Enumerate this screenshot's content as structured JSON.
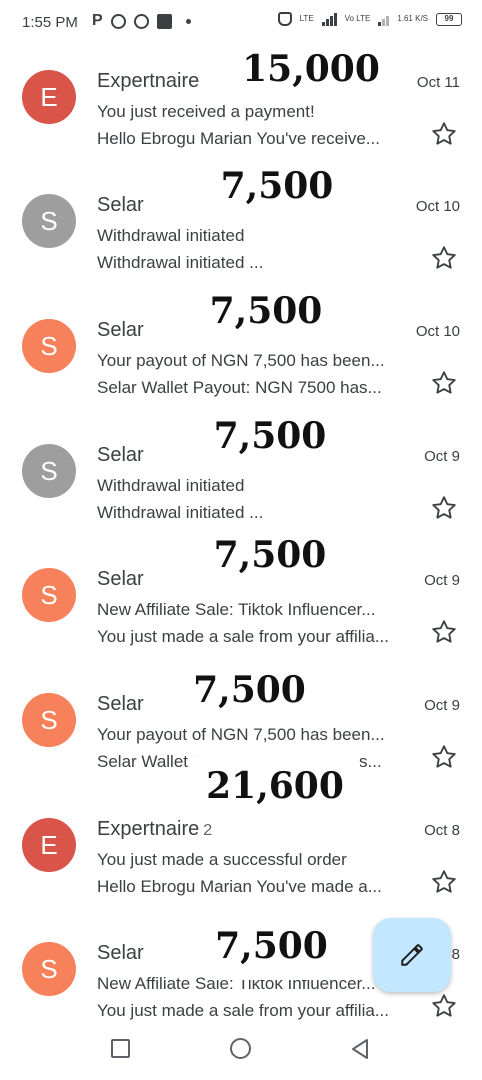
{
  "status_bar": {
    "time": "1:55 PM",
    "left_icons": [
      "p-icon",
      "whatsapp-icon",
      "facebook-icon",
      "photo-icon",
      "notification-dot"
    ],
    "lte1": "LTE",
    "lte2": "Vo LTE",
    "speed": "1.61 K/S",
    "battery": "99"
  },
  "emails": [
    {
      "initial": "E",
      "avatar_color": "#d9554a",
      "sender": "Expertnaire",
      "count": "",
      "date": "Oct 11",
      "subject": "You just received a payment!",
      "preview": "Hello Ebrogu Marian You've receive...",
      "overlay": "15,000"
    },
    {
      "initial": "S",
      "avatar_color": "#9e9e9e",
      "sender": "Selar",
      "count": "",
      "date": "Oct 10",
      "subject": "Withdrawal initiated",
      "preview": "Withdrawal initiated ...",
      "overlay": "7,500"
    },
    {
      "initial": "S",
      "avatar_color": "#f7815b",
      "sender": "Selar",
      "count": "",
      "date": "Oct 10",
      "subject": "Your payout of NGN 7,500 has been...",
      "preview": "Selar Wallet Payout: NGN 7500 has...",
      "overlay": "7,500"
    },
    {
      "initial": "S",
      "avatar_color": "#9e9e9e",
      "sender": "Selar",
      "count": "",
      "date": "Oct 9",
      "subject": "Withdrawal initiated",
      "preview": "Withdrawal initiated ...",
      "overlay": "7,500"
    },
    {
      "initial": "S",
      "avatar_color": "#f7815b",
      "sender": "Selar",
      "count": "",
      "date": "Oct 9",
      "subject": "New Affiliate Sale: Tiktok Influencer...",
      "preview": "You just made a sale from your affilia...",
      "overlay": "7,500"
    },
    {
      "initial": "S",
      "avatar_color": "#f7815b",
      "sender": "Selar",
      "count": "",
      "date": "Oct 9",
      "subject": "Your payout of NGN 7,500 has been...",
      "preview": "Selar Wallet Payout: NGN 7500 has...",
      "overlay": "7,500"
    },
    {
      "initial": "E",
      "avatar_color": "#d9554a",
      "sender": "Expertnaire",
      "count": "2",
      "date": "Oct 8",
      "subject": "You just made a successful order",
      "preview": "Hello Ebrogu Marian You've made a...",
      "overlay": "21,600"
    },
    {
      "initial": "S",
      "avatar_color": "#f7815b",
      "sender": "Selar",
      "count": "",
      "date": "Oct 8",
      "subject": "New Affiliate Sale: Tiktok Influencer...",
      "preview": "You just made a sale from your affilia...",
      "overlay": "7,500"
    }
  ],
  "fab": {
    "icon": "pencil-icon",
    "color": "#c2e7ff"
  },
  "nav": {
    "icons": [
      "recent-apps-icon",
      "home-icon",
      "back-icon"
    ]
  }
}
